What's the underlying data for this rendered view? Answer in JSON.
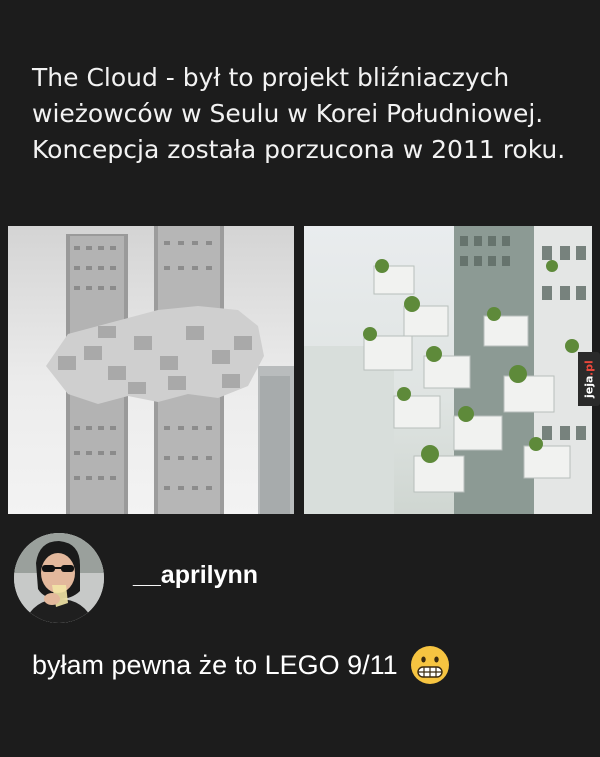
{
  "post": {
    "text": "The Cloud - był to projekt bliźniaczych wieżowców w Seulu w Korei Południowej. Koncepcja została porzucona w 2011 roku."
  },
  "images": {
    "left_alt": "towers-render",
    "right_alt": "balconies-render"
  },
  "watermark": {
    "main": "jeja",
    "suffix": ".pl"
  },
  "comment": {
    "username": "__aprilynn",
    "text": "byłam pewna że to LEGO 9/11",
    "emoji": "grimacing-face-icon"
  },
  "colors": {
    "background": "#1c1c1c",
    "text": "#ffffff",
    "emoji": "#f6c441"
  }
}
